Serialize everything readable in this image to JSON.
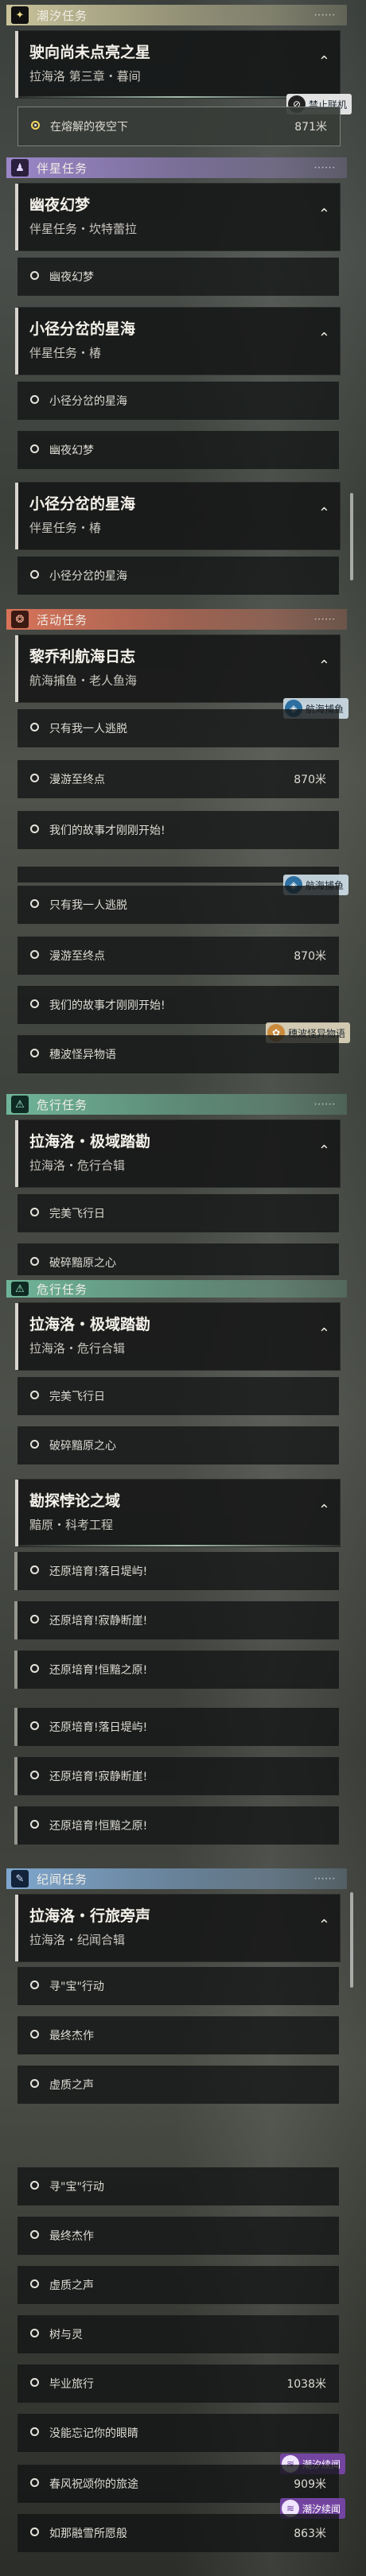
{
  "sections": {
    "chaoxi": "潮汐任务",
    "banxing": "伴星任务",
    "huodong": "活动任务",
    "weixing": "危行任务",
    "jiwen": "纪闻任务"
  },
  "missions": {
    "m1": {
      "title": "驶向尚未点亮之星",
      "sub": "拉海洛 第三章・暮间"
    },
    "m2": {
      "title": "幽夜幻梦",
      "sub": "伴星任务・坎特蕾拉"
    },
    "m3": {
      "title": "小径分岔的星海",
      "sub": "伴星任务・椿"
    },
    "m4": {
      "title": "黎乔利航海日志",
      "sub": "航海捕鱼・老人鱼海"
    },
    "m5": {
      "title": "拉海洛・极域踏勘",
      "sub": "拉海洛・危行合辑"
    },
    "m6": {
      "title": "勘探悖论之域",
      "sub": "黯原・科考工程"
    },
    "m7": {
      "title": "拉海洛・行旅旁声",
      "sub": "拉海洛・纪闻合辑"
    }
  },
  "steps": {
    "s_night": {
      "label": "在熔解的夜空下",
      "dist": "871米"
    },
    "s_youye": "幽夜幻梦",
    "s_xiaojing": "小径分岔的星海",
    "s_only": "只有我一人逃脱",
    "s_mangyou": {
      "label": "漫游至终点",
      "dist": "870米"
    },
    "s_story": "我们的故事才刚刚开始!",
    "s_suibo": "穗波怪异物语",
    "s_feixing": "完美飞行日",
    "s_posui": "破碎黯原之心",
    "s_peiyu1": "还原培育!落日堤屿!",
    "s_peiyu2": "还原培育!寂静断崖!",
    "s_peiyu3": "还原培育!恒黯之原!",
    "s_xunbao": "寻\"宝\"行动",
    "s_jiezuo": "最终杰作",
    "s_xuzhi": "虚质之声",
    "s_shu": "树与灵",
    "s_biye": {
      "label": "毕业旅行",
      "dist": "1038米"
    },
    "s_meiyou": "没能忘记你的眼睛",
    "s_chunfeng": {
      "label": "春风祝颂你的旅途",
      "dist": "909米"
    },
    "s_rumeng": {
      "label": "如那融雪所愿般",
      "dist": "863米"
    }
  },
  "badges": {
    "forbid": "禁止联机",
    "hanghai": "航海捕鱼",
    "suibo": "穗波怪异物语",
    "chaoxi_xu": "潮汐续闻"
  },
  "colors": {
    "chaoxi": "#c9c39a",
    "banxing": "#9a86c9",
    "huodong": "#d8735a",
    "weixing": "#6fb59a",
    "jiwen": "#7fa7cf",
    "jiwen_badge": "#8a4fb6"
  },
  "icons": {
    "chaoxi": "star-icon",
    "banxing": "companion-icon",
    "huodong": "event-icon",
    "weixing": "danger-icon",
    "jiwen": "journal-icon"
  }
}
